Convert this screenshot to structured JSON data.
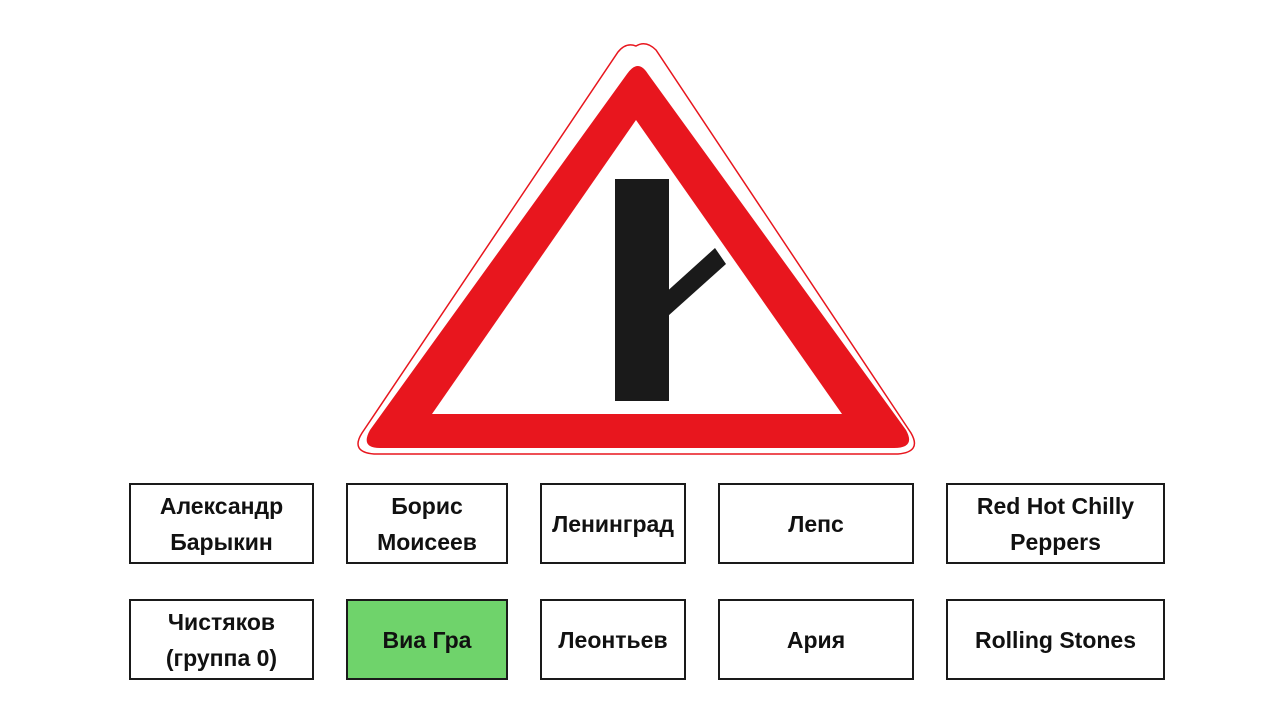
{
  "slide": {
    "sign": {
      "icon": "road-sign-side-road-junction-right-icon",
      "border_color": "#e8161e",
      "symbol_color": "#1a1a1a",
      "fill_color": "#ffffff"
    },
    "answers": [
      {
        "label": "Александр\nБарыкин",
        "selected": false
      },
      {
        "label": "Борис\nМоисеев",
        "selected": false
      },
      {
        "label": "Ленинград",
        "selected": false
      },
      {
        "label": "Лепс",
        "selected": false
      },
      {
        "label": "Red Hot Chilly\nPeppers",
        "selected": false
      },
      {
        "label": "Чистяков\n(группа 0)",
        "selected": false
      },
      {
        "label": "Виа Гра",
        "selected": true
      },
      {
        "label": "Леонтьев",
        "selected": false
      },
      {
        "label": "Ария",
        "selected": false
      },
      {
        "label": "Rolling Stones",
        "selected": false
      }
    ],
    "selected_color": "#6fd36b"
  }
}
